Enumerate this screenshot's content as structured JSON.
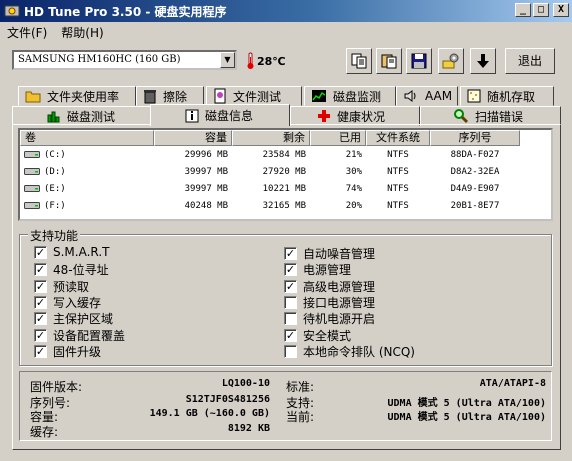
{
  "window": {
    "title": "HD Tune Pro 3.50 - 硬盘实用程序",
    "controls": {
      "minimize": "_",
      "maximize": "□",
      "close": "X"
    }
  },
  "menu": [
    {
      "label": "文件(F)"
    },
    {
      "label": "帮助(H)"
    }
  ],
  "toolbar": {
    "drive": "SAMSUNG HM160HC (160 GB)",
    "temperature": "28℃",
    "exit_label": "退出"
  },
  "tabs_row1": [
    {
      "label": "文件夹使用率",
      "icon": "folder-icon"
    },
    {
      "label": "擦除",
      "icon": "trash-icon"
    },
    {
      "label": "文件测试",
      "icon": "file-test-icon"
    },
    {
      "label": "磁盘监测",
      "icon": "monitor-chart-icon"
    },
    {
      "label": "AAM",
      "icon": "speaker-icon"
    },
    {
      "label": "随机存取",
      "icon": "random-access-icon"
    }
  ],
  "tabs_row2": [
    {
      "label": "磁盘测试",
      "icon": "bar-chart-icon"
    },
    {
      "label": "磁盘信息",
      "icon": "info-icon"
    },
    {
      "label": "健康状况",
      "icon": "health-cross-icon"
    },
    {
      "label": "扫描错误",
      "icon": "magnifier-icon"
    }
  ],
  "volumes": {
    "headers": [
      "卷",
      "容量",
      "剩余",
      "已用",
      "文件系统",
      "序列号"
    ],
    "rows": [
      {
        "drive": "(C:)",
        "capacity": "29996 MB",
        "free": "23584 MB",
        "used": "21%",
        "fs": "NTFS",
        "serial": "88DA-F027"
      },
      {
        "drive": "(D:)",
        "capacity": "39997 MB",
        "free": "27920 MB",
        "used": "30%",
        "fs": "NTFS",
        "serial": "D8A2-32EA"
      },
      {
        "drive": "(E:)",
        "capacity": "39997 MB",
        "free": "10221 MB",
        "used": "74%",
        "fs": "NTFS",
        "serial": "D4A9-E907"
      },
      {
        "drive": "(F:)",
        "capacity": "40248 MB",
        "free": "32165 MB",
        "used": "20%",
        "fs": "NTFS",
        "serial": "20B1-8E77"
      }
    ]
  },
  "features": {
    "group_label": "支持功能",
    "left": [
      {
        "label": "S.M.A.R.T",
        "checked": true
      },
      {
        "label": "48-位寻址",
        "checked": true
      },
      {
        "label": "预读取",
        "checked": true
      },
      {
        "label": "写入缓存",
        "checked": true
      },
      {
        "label": "主保护区域",
        "checked": true
      },
      {
        "label": "设备配置覆盖",
        "checked": true
      },
      {
        "label": "固件升级",
        "checked": true
      }
    ],
    "right": [
      {
        "label": "自动噪音管理",
        "checked": true
      },
      {
        "label": "电源管理",
        "checked": true
      },
      {
        "label": "高级电源管理",
        "checked": true
      },
      {
        "label": "接口电源管理",
        "checked": false
      },
      {
        "label": "待机电源开启",
        "checked": false
      },
      {
        "label": "安全模式",
        "checked": true
      },
      {
        "label": "本地命令排队 (NCQ)",
        "checked": false
      }
    ]
  },
  "info": {
    "firmware_label": "固件版本:",
    "firmware": "LQ100-10",
    "serial_label": "序列号:",
    "serial": "S12TJF0S481256",
    "capacity_label": "容量:",
    "capacity": "149.1 GB (~160.0 GB)",
    "cache_label": "缓存:",
    "cache": "8192 KB",
    "standard_label": "标准:",
    "standard": "ATA/ATAPI-8",
    "supported_label": "支持:",
    "supported": "UDMA 模式 5 (Ultra ATA/100)",
    "current_label": "当前:",
    "current": "UDMA 模式 5 (Ultra ATA/100)"
  }
}
